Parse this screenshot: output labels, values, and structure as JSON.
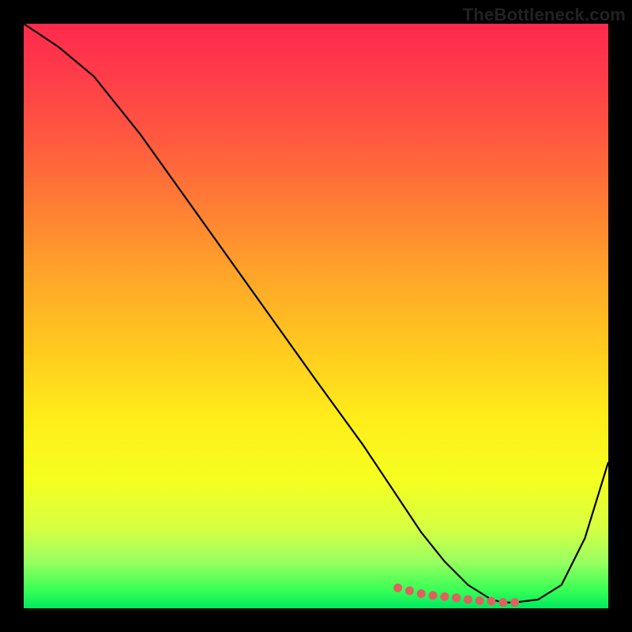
{
  "watermark": "TheBottleneck.com",
  "chart_data": {
    "type": "line",
    "title": "",
    "xlabel": "",
    "ylabel": "",
    "xlim": [
      0,
      100
    ],
    "ylim": [
      0,
      100
    ],
    "series": [
      {
        "name": "curve",
        "color": "#000000",
        "x": [
          0,
          6,
          12,
          20,
          30,
          40,
          50,
          58,
          64,
          68,
          72,
          76,
          80,
          82,
          84,
          88,
          92,
          96,
          100
        ],
        "values": [
          100,
          96,
          91,
          81,
          67,
          53,
          39,
          28,
          19,
          13,
          8,
          4,
          1.5,
          1,
          1,
          1.5,
          4,
          12,
          25
        ]
      }
    ],
    "markers": {
      "name": "optimal-range",
      "color": "#e06060",
      "x": [
        64,
        66,
        68,
        70,
        72,
        74,
        76,
        78,
        80,
        82,
        84
      ],
      "values": [
        3.5,
        3.0,
        2.5,
        2.2,
        2.0,
        1.8,
        1.5,
        1.3,
        1.2,
        1.0,
        1.0
      ]
    }
  }
}
